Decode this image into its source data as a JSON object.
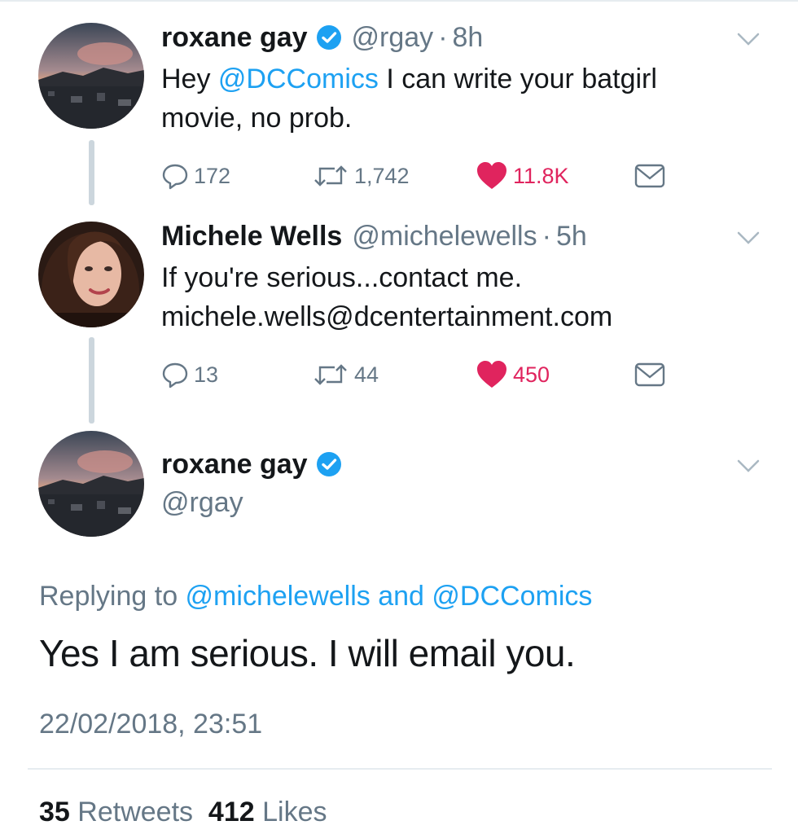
{
  "tweet1": {
    "name": "roxane gay",
    "handle": "@rgay",
    "separator": "·",
    "time": "8h",
    "text_before": "Hey ",
    "mention": "@DCComics",
    "text_line1_after": " I can write your batgirl",
    "text_line2": "movie, no prob.",
    "replies": "172",
    "retweets": "1,742",
    "likes": "11.8K"
  },
  "tweet2": {
    "name": "Michele Wells",
    "handle": "@michelewells",
    "separator": "·",
    "time": "5h",
    "text_line1": "If you're serious...contact me.",
    "text_line2": "michele.wells@dcentertainment.com",
    "replies": "13",
    "retweets": "44",
    "likes": "450"
  },
  "tweet3": {
    "name": "roxane gay",
    "handle": "@rgay",
    "replying_prefix": "Replying to ",
    "replying_mention1": "@michelewells",
    "replying_and": " and ",
    "replying_mention2": "@DCComics",
    "text": "Yes I am serious. I will email you.",
    "timestamp": "22/02/2018, 23:51",
    "retweet_count": "35",
    "retweet_label": "Retweets",
    "like_count": "412",
    "like_label": "Likes"
  },
  "icons": {
    "reply": "reply-icon",
    "retweet": "retweet-icon",
    "like": "heart-icon",
    "dm": "envelope-icon",
    "verified": "verified-badge-icon",
    "caret": "chevron-down-icon"
  },
  "colors": {
    "link": "#1da1f2",
    "like": "#e0245e",
    "secondary_text": "#657786",
    "primary_text": "#14171a"
  }
}
